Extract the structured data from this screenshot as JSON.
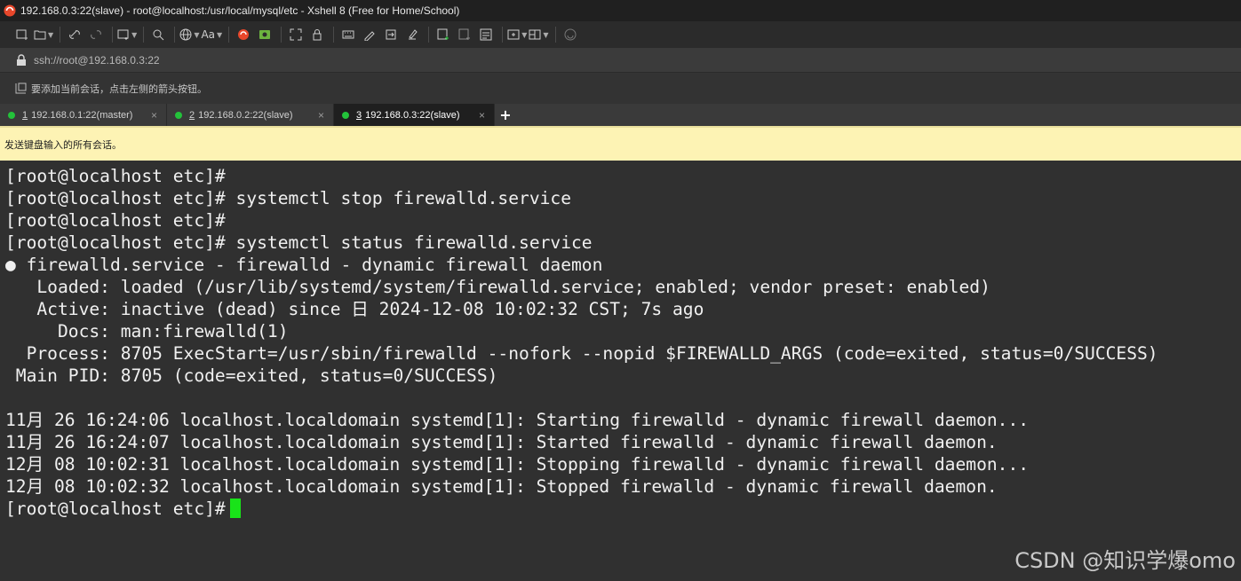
{
  "window": {
    "title": "192.168.0.3:22(slave) - root@localhost:/usr/local/mysql/etc - Xshell 8 (Free for Home/School)"
  },
  "toolbar": {
    "buttons": [
      "new-session",
      "open",
      "link",
      "unlink",
      "new-window",
      "find",
      "globe",
      "font",
      "xshell-logo",
      "xftp",
      "fullscreen",
      "lock",
      "keyboard",
      "script",
      "transfer",
      "compose",
      "new-tab",
      "copy-tab",
      "tab-list",
      "folder",
      "layout",
      "help"
    ],
    "font_label": "Aa"
  },
  "address": {
    "url": "ssh://root@192.168.0.3:22"
  },
  "hint": {
    "text": "要添加当前会话，点击左侧的箭头按钮。"
  },
  "tabs": [
    {
      "num": "1",
      "label": "192.168.0.1:22(master)",
      "active": false
    },
    {
      "num": "2",
      "label": "192.168.0.2:22(slave)",
      "active": false
    },
    {
      "num": "3",
      "label": "192.168.0.3:22(slave)",
      "active": true
    }
  ],
  "tab_add": "+",
  "tab_close": "×",
  "notice": {
    "text": "发送键盘输入的所有会话。"
  },
  "terminal": {
    "lines": [
      "[root@localhost etc]#",
      "[root@localhost etc]# systemctl stop firewalld.service",
      "[root@localhost etc]#",
      "[root@localhost etc]# systemctl status firewalld.service",
      "● firewalld.service - firewalld - dynamic firewall daemon",
      "   Loaded: loaded (/usr/lib/systemd/system/firewalld.service; enabled; vendor preset: enabled)",
      "   Active: inactive (dead) since 日 2024-12-08 10:02:32 CST; 7s ago",
      "     Docs: man:firewalld(1)",
      "  Process: 8705 ExecStart=/usr/sbin/firewalld --nofork --nopid $FIREWALLD_ARGS (code=exited, status=0/SUCCESS)",
      " Main PID: 8705 (code=exited, status=0/SUCCESS)",
      "",
      "11月 26 16:24:06 localhost.localdomain systemd[1]: Starting firewalld - dynamic firewall daemon...",
      "11月 26 16:24:07 localhost.localdomain systemd[1]: Started firewalld - dynamic firewall daemon.",
      "12月 08 10:02:31 localhost.localdomain systemd[1]: Stopping firewalld - dynamic firewall daemon...",
      "12月 08 10:02:32 localhost.localdomain systemd[1]: Stopped firewalld - dynamic firewall daemon."
    ],
    "prompt": "[root@localhost etc]#"
  },
  "watermark": "CSDN @知识学爆omo",
  "colors": {
    "terminal_bg": "#303030",
    "cursor": "#19e319",
    "notice_bg": "#fdf3b4",
    "tab_dot": "#23c23a"
  }
}
